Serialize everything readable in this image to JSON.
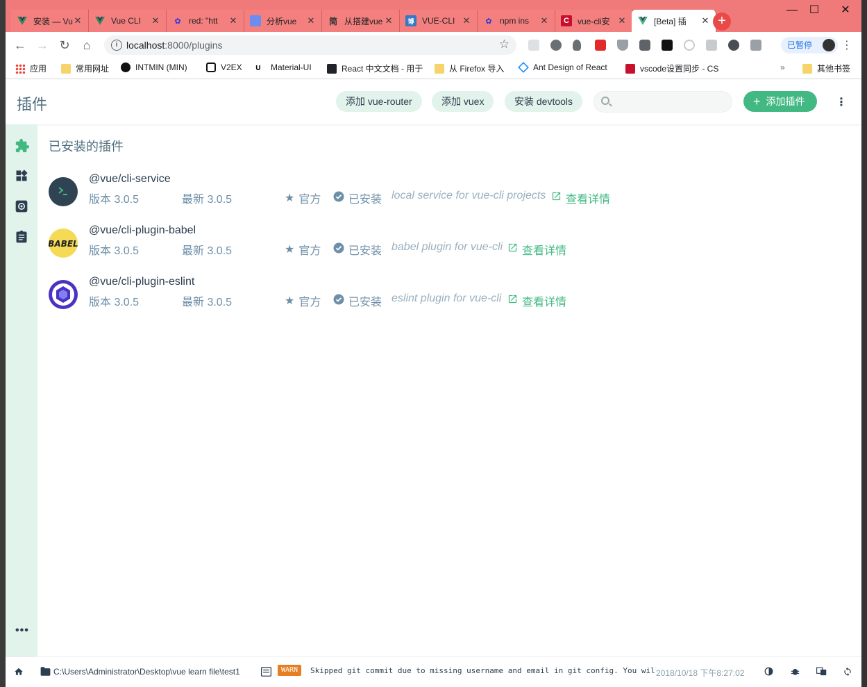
{
  "browser": {
    "tabs": [
      {
        "title": "安装 — Vue",
        "icon": "vue-icon"
      },
      {
        "title": "Vue CLI",
        "icon": "vue-icon"
      },
      {
        "title": "red: \"htt",
        "icon": "baidu-icon"
      },
      {
        "title": "分析vue",
        "icon": "csdn-icon"
      },
      {
        "title": "从搭建vue",
        "icon": "jianshu-icon"
      },
      {
        "title": "VUE-CLI",
        "icon": "cnblogs-icon"
      },
      {
        "title": "npm ins",
        "icon": "baidu-icon"
      },
      {
        "title": "vue-cli安",
        "icon": "csdn-icon"
      },
      {
        "title": "[Beta] 插",
        "icon": "vue-icon",
        "active": true
      }
    ],
    "url_host": "localhost",
    "url_path": ":8000/plugins",
    "profile_label": "已暂停",
    "bookmarks": [
      {
        "label": "应用",
        "icon": "apps-icon"
      },
      {
        "label": "常用网址",
        "icon": "folder-icon"
      },
      {
        "label": "INTMIN (MIN)",
        "icon": "github-icon"
      },
      {
        "label": "V2EX",
        "icon": "v2ex-icon"
      },
      {
        "label": "Material-UI",
        "icon": "material-ui-icon"
      },
      {
        "label": "React 中文文档 - 用于",
        "icon": "react-icon"
      },
      {
        "label": "从 Firefox 导入",
        "icon": "folder-icon"
      },
      {
        "label": "Ant Design of React",
        "icon": "antd-icon"
      },
      {
        "label": "vscode设置同步 - CS",
        "icon": "csdn-icon"
      },
      {
        "label": "其他书签",
        "icon": "folder-icon"
      }
    ],
    "overflow_label": "»"
  },
  "header": {
    "title": "插件",
    "buttons": {
      "add_router": "添加 vue-router",
      "add_vuex": "添加 vuex",
      "install_devtools": "安装 devtools"
    },
    "search_placeholder": "",
    "add_plugin": "添加插件"
  },
  "section_title": "已安装的插件",
  "plugins": [
    {
      "name": "@vue/cli-service",
      "version": "版本 3.0.5",
      "latest": "最新 3.0.5",
      "official": "官方",
      "installed": "已安装",
      "description": "local service for vue-cli projects",
      "details": "查看详情"
    },
    {
      "name": "@vue/cli-plugin-babel",
      "version": "版本 3.0.5",
      "latest": "最新 3.0.5",
      "official": "官方",
      "installed": "已安装",
      "description": "babel plugin for vue-cli",
      "details": "查看详情"
    },
    {
      "name": "@vue/cli-plugin-eslint",
      "version": "版本 3.0.5",
      "latest": "最新 3.0.5",
      "official": "官方",
      "installed": "已安装",
      "description": "eslint plugin for vue-cli",
      "details": "查看详情"
    }
  ],
  "logo_text": {
    "babel": "BABEL"
  },
  "statusbar": {
    "path": "C:\\Users\\Administrator\\Desktop\\vue learn file\\test1",
    "warn_badge": "WARN",
    "log": "Skipped git commit due to missing username and email in git config. You will need to…",
    "timestamp": "2018/10/18 下午8:27:02"
  },
  "colors": {
    "accent": "#42b983",
    "accent_light": "#e1f3ea",
    "title": "#4f6f7f",
    "text": "#2c3e50",
    "muted": "#6e8fa8",
    "warn": "#e67e22",
    "tabstrip": "#f07a7a"
  }
}
